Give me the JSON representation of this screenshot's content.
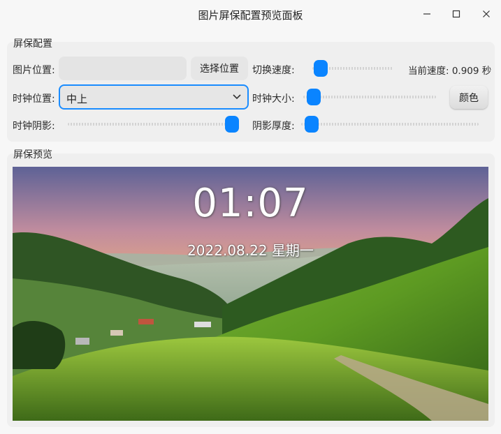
{
  "window": {
    "title": "图片屏保配置预览面板",
    "controls": [
      "minimize-icon",
      "maximize-icon",
      "close-icon"
    ]
  },
  "config": {
    "group_title": "屏保配置",
    "image_location_label": "图片位置:",
    "image_location_value": "",
    "select_location_button": "选择位置",
    "switch_speed_label": "切换速度:",
    "switch_speed_level": 0.02,
    "current_speed_text": "当前速度: 0.909 秒",
    "clock_position_label": "时钟位置:",
    "clock_position_value": "中上",
    "clock_size_label": "时钟大小:",
    "clock_size_level": 0.03,
    "color_button": "颜色",
    "clock_shadow_label": "时钟阴影:",
    "clock_shadow_level": 1.0,
    "shadow_thickness_label": "阴影厚度:",
    "shadow_thickness_level": 0.02
  },
  "preview": {
    "group_title": "屏保预览",
    "clock_time": "01:07",
    "clock_date": "2022.08.22 星期一"
  },
  "colors": {
    "accent": "#0a84ff",
    "focus_border": "#1a8cff"
  }
}
